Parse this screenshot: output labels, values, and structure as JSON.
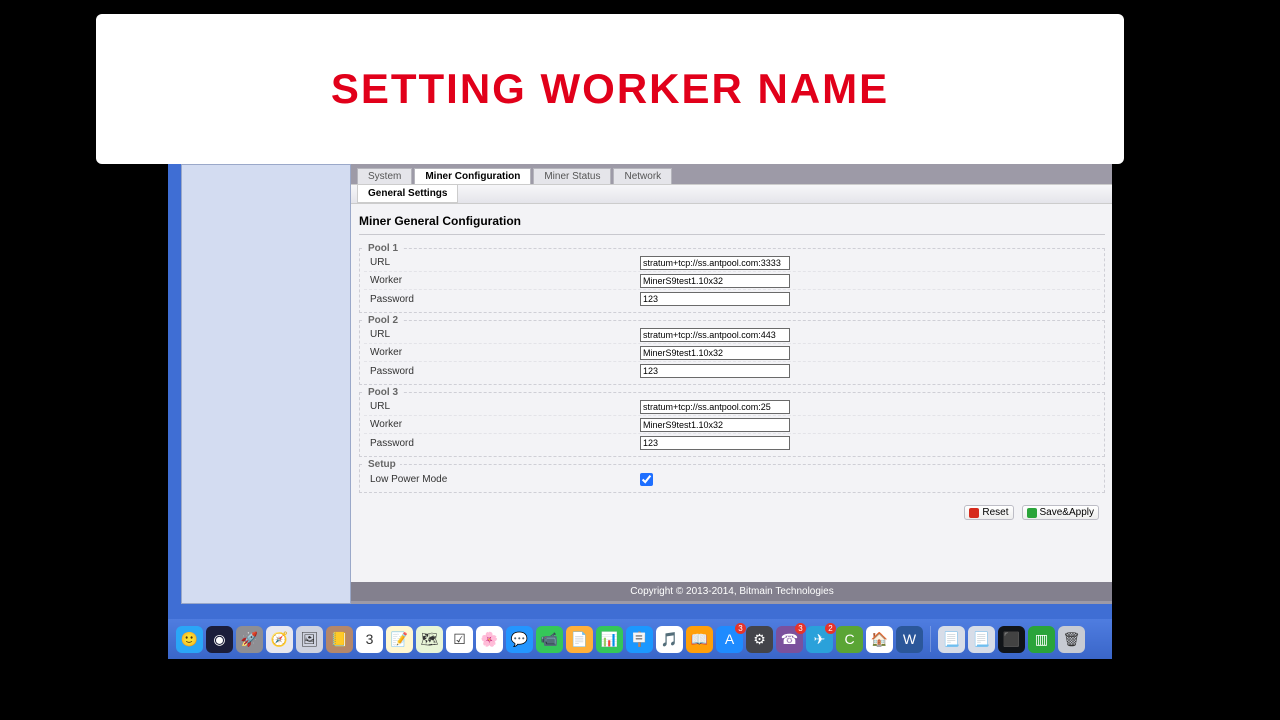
{
  "banner": {
    "title": "SETTING WORKER NAME"
  },
  "tabs": {
    "items": [
      "System",
      "Miner Configuration",
      "Miner Status",
      "Network"
    ],
    "active_index": 1
  },
  "subtabs": {
    "items": [
      "General Settings"
    ],
    "active_index": 0
  },
  "page": {
    "title": "Miner General Configuration"
  },
  "pools": [
    {
      "legend": "Pool 1",
      "url_label": "URL",
      "url": "stratum+tcp://ss.antpool.com:3333",
      "worker_label": "Worker",
      "worker": "MinerS9test1.10x32",
      "password_label": "Password",
      "password": "123"
    },
    {
      "legend": "Pool 2",
      "url_label": "URL",
      "url": "stratum+tcp://ss.antpool.com:443",
      "worker_label": "Worker",
      "worker": "MinerS9test1.10x32",
      "password_label": "Password",
      "password": "123"
    },
    {
      "legend": "Pool 3",
      "url_label": "URL",
      "url": "stratum+tcp://ss.antpool.com:25",
      "worker_label": "Worker",
      "worker": "MinerS9test1.10x32",
      "password_label": "Password",
      "password": "123"
    }
  ],
  "setup": {
    "legend": "Setup",
    "low_power_label": "Low Power Mode",
    "low_power_checked": true
  },
  "actions": {
    "reset": "Reset",
    "save_apply": "Save&Apply"
  },
  "copyright": "Copyright © 2013-2014, Bitmain Technologies",
  "dock": {
    "items": [
      {
        "name": "finder-icon",
        "bg": "#2aa6f7",
        "glyph": "🙂",
        "badge": null
      },
      {
        "name": "siri-icon",
        "bg": "#1b1d3a",
        "glyph": "◉",
        "badge": null
      },
      {
        "name": "launchpad-icon",
        "bg": "#8e8e93",
        "glyph": "🚀",
        "badge": null
      },
      {
        "name": "safari-icon",
        "bg": "#e8e8ef",
        "glyph": "🧭",
        "badge": null
      },
      {
        "name": "preview-icon",
        "bg": "#cfd3df",
        "glyph": "🖼",
        "badge": null
      },
      {
        "name": "contacts-icon",
        "bg": "#b4876a",
        "glyph": "📒",
        "badge": null
      },
      {
        "name": "calendar-icon",
        "bg": "#ffffff",
        "glyph": "3",
        "badge": null
      },
      {
        "name": "notes-icon",
        "bg": "#fff7d1",
        "glyph": "📝",
        "badge": null
      },
      {
        "name": "maps-icon",
        "bg": "#e8f5d7",
        "glyph": "🗺",
        "badge": null
      },
      {
        "name": "reminders-icon",
        "bg": "#ffffff",
        "glyph": "☑",
        "badge": null
      },
      {
        "name": "photos-icon",
        "bg": "#ffffff",
        "glyph": "🌸",
        "badge": null
      },
      {
        "name": "messages-icon",
        "bg": "#2396ff",
        "glyph": "💬",
        "badge": null
      },
      {
        "name": "facetime-icon",
        "bg": "#35c759",
        "glyph": "📹",
        "badge": null
      },
      {
        "name": "pages-icon",
        "bg": "#ffb03a",
        "glyph": "📄",
        "badge": null
      },
      {
        "name": "numbers-icon",
        "bg": "#34c759",
        "glyph": "📊",
        "badge": null
      },
      {
        "name": "keynote-icon",
        "bg": "#1b98ff",
        "glyph": "🪧",
        "badge": null
      },
      {
        "name": "itunes-icon",
        "bg": "#ffffff",
        "glyph": "🎵",
        "badge": null
      },
      {
        "name": "ibooks-icon",
        "bg": "#ff9f0a",
        "glyph": "📖",
        "badge": null
      },
      {
        "name": "appstore-icon",
        "bg": "#1e8bff",
        "glyph": "A",
        "badge": "3"
      },
      {
        "name": "settings-icon",
        "bg": "#43444a",
        "glyph": "⚙",
        "badge": null
      },
      {
        "name": "viber-icon",
        "bg": "#7b519d",
        "glyph": "☎",
        "badge": "3"
      },
      {
        "name": "telegram-icon",
        "bg": "#2aa1da",
        "glyph": "✈",
        "badge": "2"
      },
      {
        "name": "camtasia-icon",
        "bg": "#5aa535",
        "glyph": "C",
        "badge": null
      },
      {
        "name": "home-app-icon",
        "bg": "#ffffff",
        "glyph": "🏠",
        "badge": null
      },
      {
        "name": "word-icon",
        "bg": "#2b579a",
        "glyph": "W",
        "badge": null
      }
    ],
    "right_items": [
      {
        "name": "doc1-icon",
        "bg": "#d7dde8",
        "glyph": "📃"
      },
      {
        "name": "doc2-icon",
        "bg": "#d7dde8",
        "glyph": "📃"
      },
      {
        "name": "black-window-icon",
        "bg": "#111418",
        "glyph": "⬛"
      },
      {
        "name": "green-folder-icon",
        "bg": "#2aa43a",
        "glyph": "▥"
      },
      {
        "name": "trash-icon",
        "bg": "#c7cbd3",
        "glyph": "🗑"
      }
    ]
  }
}
